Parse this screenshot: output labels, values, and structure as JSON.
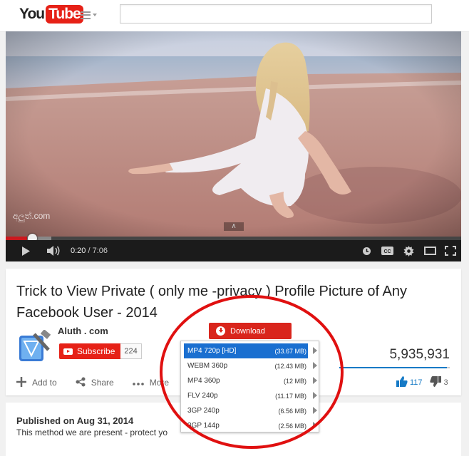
{
  "header": {
    "logo_you": "You",
    "logo_tube": "Tube",
    "guide_icon": "menu-icon",
    "search_value": "",
    "search_placeholder": ""
  },
  "player": {
    "watermark": "අලුත්.com",
    "current_time": "0:20",
    "separator": " / ",
    "duration": "7:06",
    "progress_fraction": 0.047,
    "icons": [
      "play-icon",
      "volume-icon",
      "watch-later-icon",
      "captions-icon",
      "settings-icon",
      "theater-icon",
      "fullscreen-icon"
    ]
  },
  "video": {
    "title": "Trick to View Private ( only me -privacy ) Profile Picture of Any Facebook User - 2014",
    "channel": "Aluth . com",
    "subscribe_label": "Subscribe",
    "subscriber_count": "224",
    "views": "5,935,931",
    "actions": {
      "add_to": "Add to",
      "share": "Share",
      "more": "More"
    },
    "likes": "117",
    "dislikes": "3"
  },
  "description": {
    "published": "Published on Aug 31, 2014",
    "text": "This method we are present - protect yo"
  },
  "download": {
    "button_label": "Download",
    "options": [
      {
        "format": "MP4 720p [HD]",
        "size": "(33.67 MB)",
        "selected": true
      },
      {
        "format": "WEBM 360p",
        "size": "(12.43 MB)",
        "selected": false
      },
      {
        "format": "MP4 360p",
        "size": "(12 MB)",
        "selected": false
      },
      {
        "format": "FLV 240p",
        "size": "(11.17 MB)",
        "selected": false
      },
      {
        "format": "3GP 240p",
        "size": "(6.56 MB)",
        "selected": false
      },
      {
        "format": "3GP 144p",
        "size": "(2.56 MB)",
        "selected": false
      }
    ]
  },
  "colors": {
    "brand_red": "#e62117",
    "accent_blue": "#167ac6",
    "selection_blue": "#1a6fd0",
    "annotation_red": "#e01010"
  }
}
